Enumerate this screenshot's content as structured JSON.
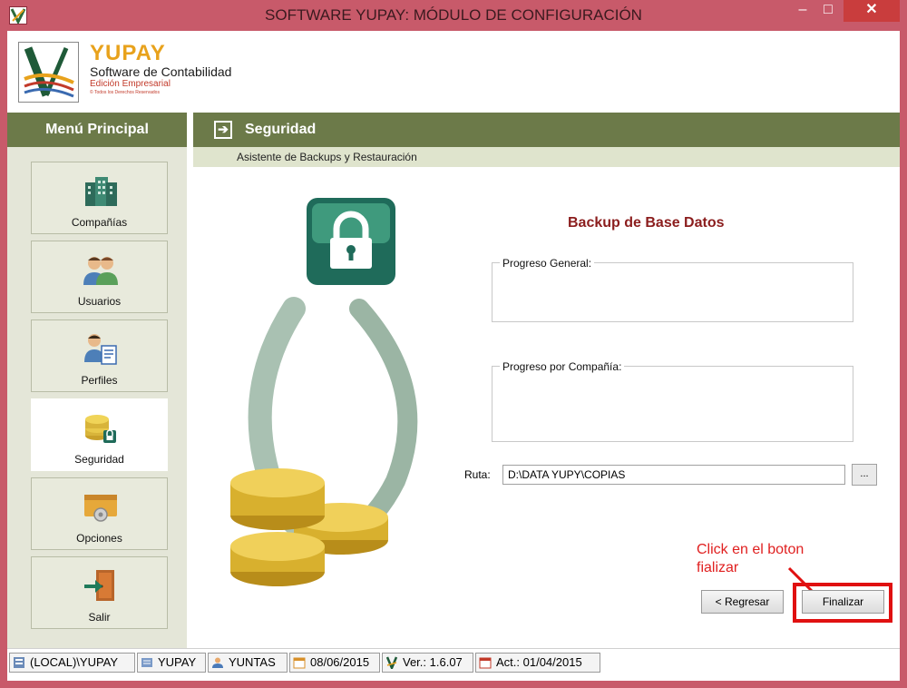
{
  "window": {
    "title": "SOFTWARE YUPAY: MÓDULO DE CONFIGURACIÓN",
    "min_glyph": "–",
    "max_glyph": "□",
    "close_glyph": "✕"
  },
  "brand": {
    "name": "YUPAY",
    "subtitle": "Software de Contabilidad",
    "edition": "Edición Empresarial",
    "copyright": "© Todos los Derechos Reservados"
  },
  "sidebar": {
    "title": "Menú Principal",
    "items": [
      {
        "label": "Compañías",
        "icon": "buildings-icon"
      },
      {
        "label": "Usuarios",
        "icon": "users-icon"
      },
      {
        "label": "Perfiles",
        "icon": "profile-icon"
      },
      {
        "label": "Seguridad",
        "icon": "security-coins-icon",
        "active": true
      },
      {
        "label": "Opciones",
        "icon": "options-icon"
      },
      {
        "label": "Salir",
        "icon": "exit-door-icon"
      }
    ]
  },
  "main": {
    "section_title": "Seguridad",
    "section_icon": "arrow-right-icon",
    "subtitle": "Asistente de Backups y Restauración",
    "backup_title": "Backup de Base Datos",
    "group_general": "Progreso General:",
    "group_company": "Progreso por Compañía:",
    "ruta_label": "Ruta:",
    "ruta_value": "D:\\DATA YUPY\\COPIAS",
    "browse_label": "...",
    "back_button": "< Regresar",
    "finish_button": "Finalizar",
    "annotation": "Click en el boton fializar"
  },
  "statusbar": {
    "items": [
      {
        "label": "(LOCAL)\\YUPAY",
        "icon": "server-icon"
      },
      {
        "label": "YUPAY",
        "icon": "database-icon"
      },
      {
        "label": "YUNTAS",
        "icon": "user-icon"
      },
      {
        "label": "08/06/2015",
        "icon": "calendar-icon"
      },
      {
        "label": "Ver.: 1.6.07",
        "icon": "yupay-logo-icon"
      },
      {
        "label": "Act.: 01/04/2015",
        "icon": "update-calendar-icon"
      }
    ]
  },
  "colors": {
    "frame": "#c85a6a",
    "olive_bar": "#6c7a49",
    "brand_orange": "#e8a21c",
    "backup_title": "#8b1d1d",
    "annotation_red": "#e01010"
  }
}
